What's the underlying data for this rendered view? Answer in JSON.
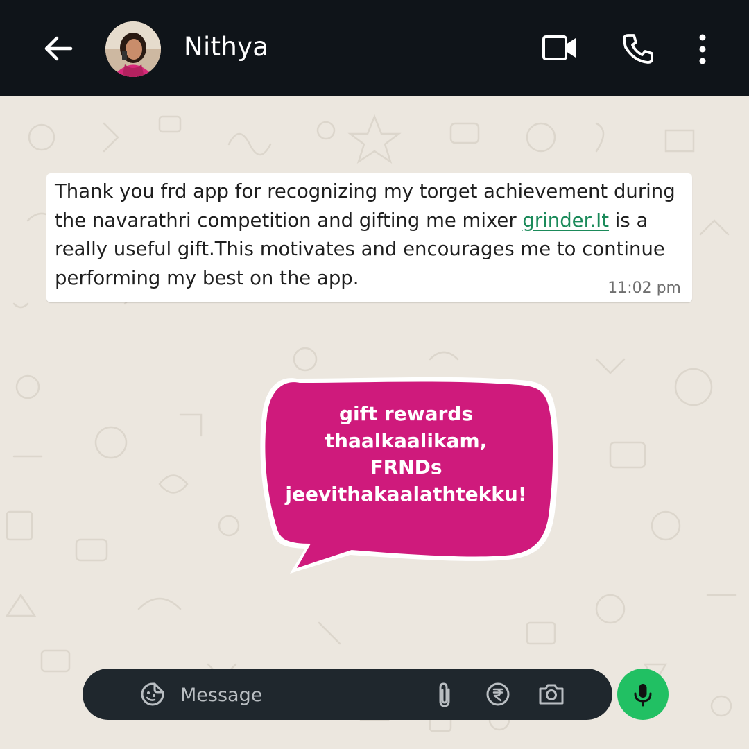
{
  "header": {
    "contact_name": "Nithya",
    "background_color": "#0f1419"
  },
  "message": {
    "text_before_link": "Thank you frd app for recognizing my torget achievement during the navarathri competition  and gifting me mixer ",
    "link_text": "grinder.It",
    "text_after_link": " is a really useful gift.This motivates and encourages me to continue performing my best on the app.",
    "time": "11:02 pm",
    "link_color": "#1b8a5a"
  },
  "callout": {
    "lines": [
      "gift rewards",
      "thaalkaalikam,",
      "FRNDs",
      "jeevithakaalathtekku!"
    ],
    "color": "#cf1a7c"
  },
  "composer": {
    "placeholder": "Message",
    "mic_color": "#21c063"
  },
  "icons": [
    "back-arrow-icon",
    "video-call-icon",
    "phone-icon",
    "more-vertical-icon",
    "sticker-icon",
    "attachment-icon",
    "rupee-icon",
    "camera-icon",
    "microphone-icon"
  ]
}
